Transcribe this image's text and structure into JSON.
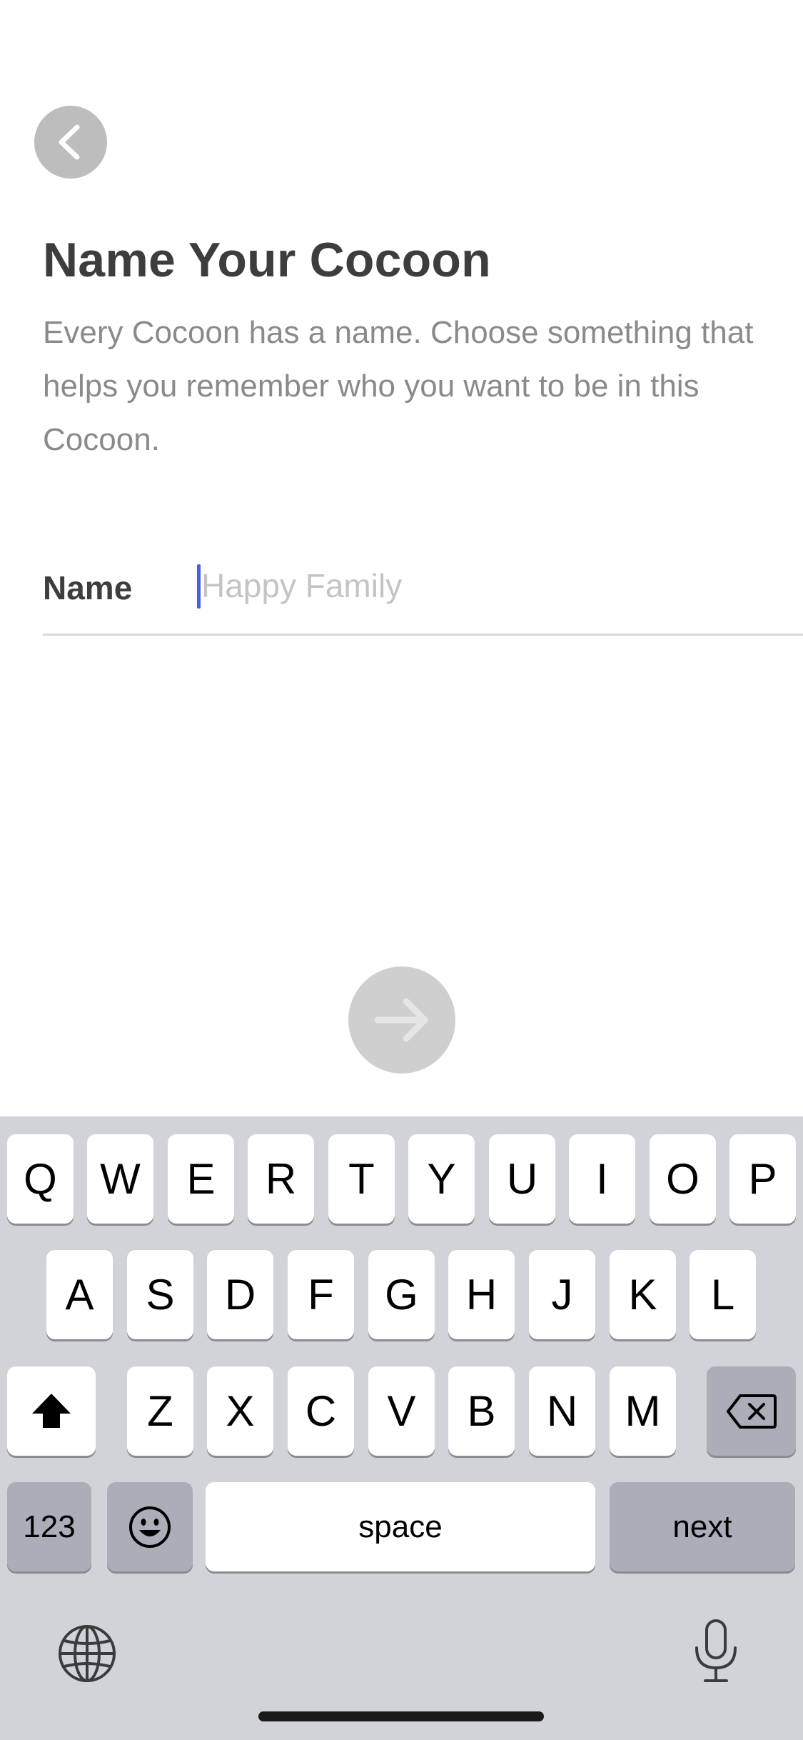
{
  "header": {
    "title": "Name Your Cocoon",
    "description": "Every Cocoon has a name. Choose something that helps you remember who you want to be in this Cocoon."
  },
  "form": {
    "name_label": "Name",
    "name_value": "",
    "name_placeholder": "Happy Family"
  },
  "icons": {
    "back": "chevron-left-icon",
    "next": "arrow-right-icon",
    "shift": "shift-icon",
    "delete": "delete-icon",
    "emoji": "emoji-icon",
    "globe": "globe-icon",
    "mic": "microphone-icon"
  },
  "keyboard": {
    "row1": [
      "Q",
      "W",
      "E",
      "R",
      "T",
      "Y",
      "U",
      "I",
      "O",
      "P"
    ],
    "row2": [
      "A",
      "S",
      "D",
      "F",
      "G",
      "H",
      "J",
      "K",
      "L"
    ],
    "row3": [
      "Z",
      "X",
      "C",
      "V",
      "B",
      "N",
      "M"
    ],
    "numbers_label": "123",
    "space_label": "space",
    "return_label": "next"
  },
  "colors": {
    "title": "#3d3d3d",
    "description": "#8a8a8a",
    "caret": "#4a5fe0",
    "button_disabled": "#cfcfcf",
    "keyboard_bg": "#d1d3d9"
  }
}
